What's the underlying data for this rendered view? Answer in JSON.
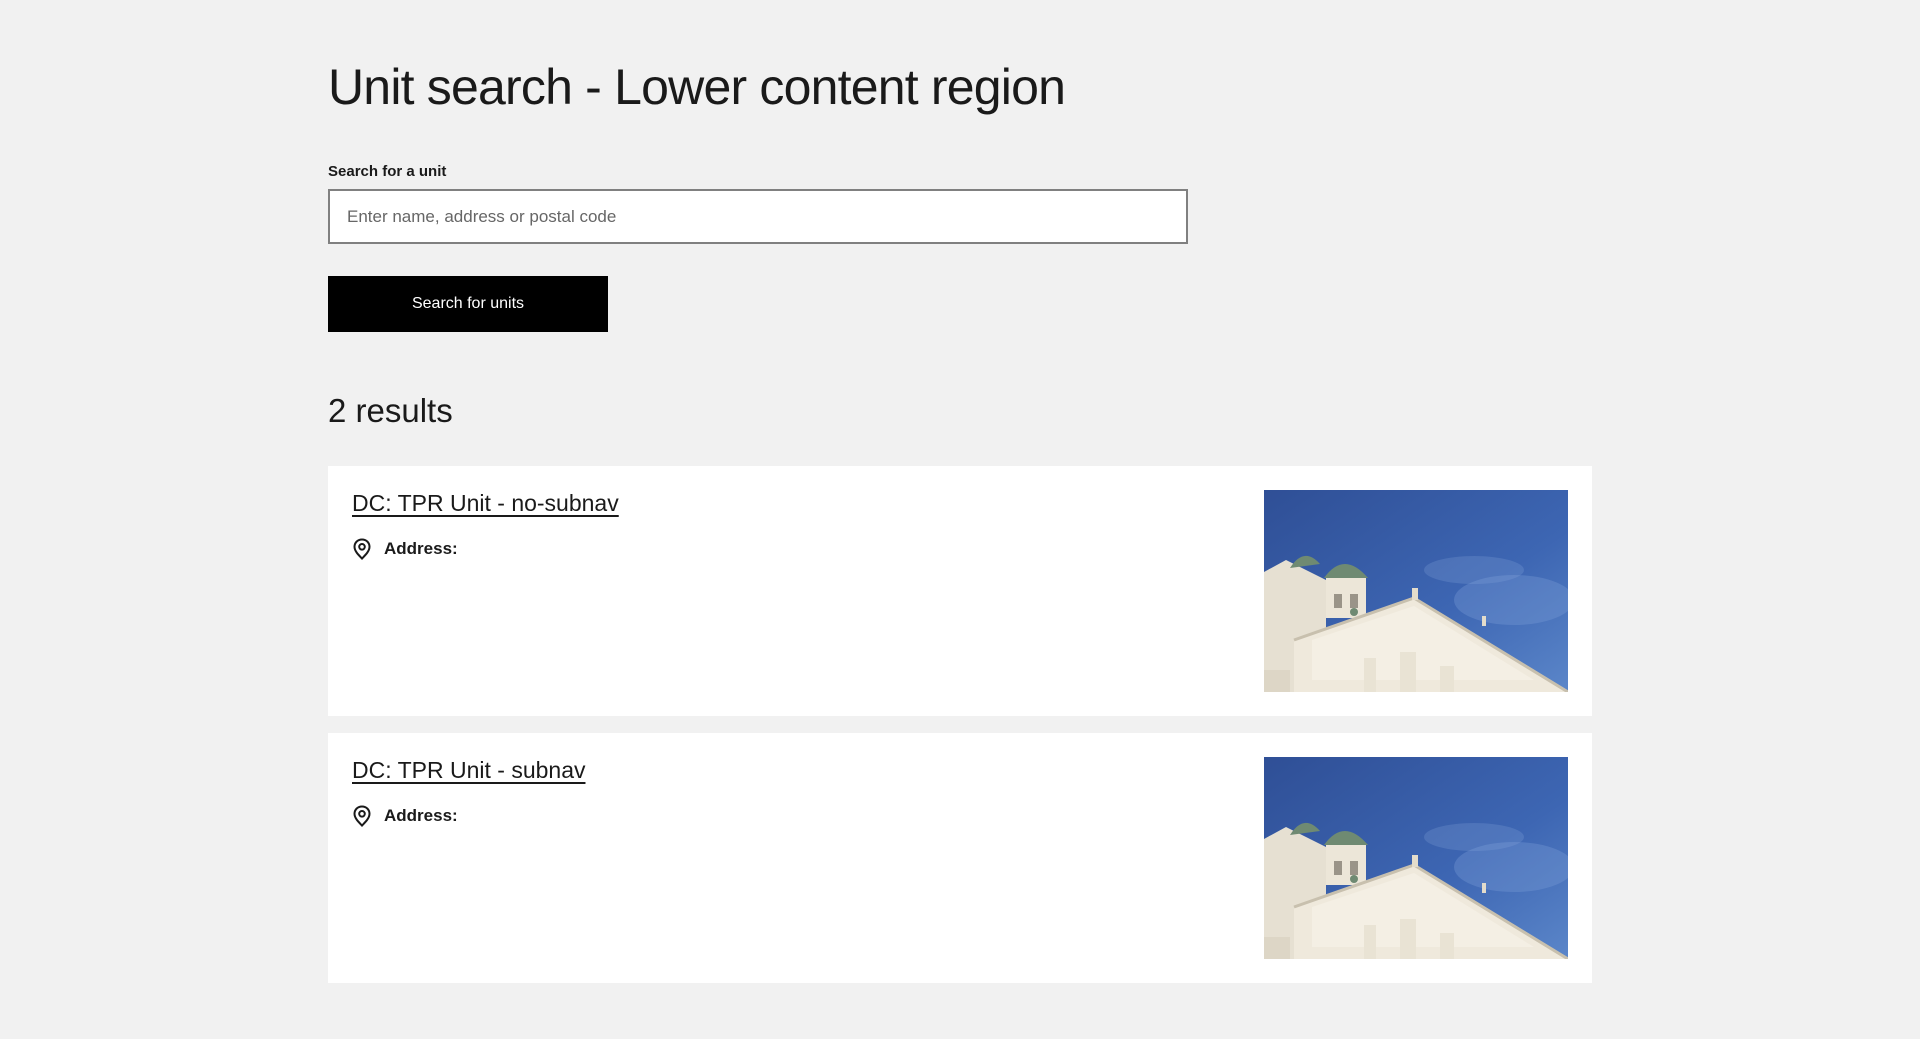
{
  "page": {
    "title": "Unit search - Lower content region"
  },
  "search": {
    "label": "Search for a unit",
    "placeholder": "Enter name, address or postal code",
    "value": "",
    "button_label": "Search for units"
  },
  "results": {
    "count_label": "2 results",
    "items": [
      {
        "title": "DC: TPR Unit - no-subnav",
        "address_label": "Address:",
        "icon": "location-pin-icon",
        "image": "cathedral-photo"
      },
      {
        "title": "DC: TPR Unit - subnav",
        "address_label": "Address:",
        "icon": "location-pin-icon",
        "image": "cathedral-photo"
      }
    ]
  },
  "colors": {
    "background": "#f1f1f1",
    "card": "#ffffff",
    "button": "#000000",
    "text": "#1a1a1a"
  }
}
